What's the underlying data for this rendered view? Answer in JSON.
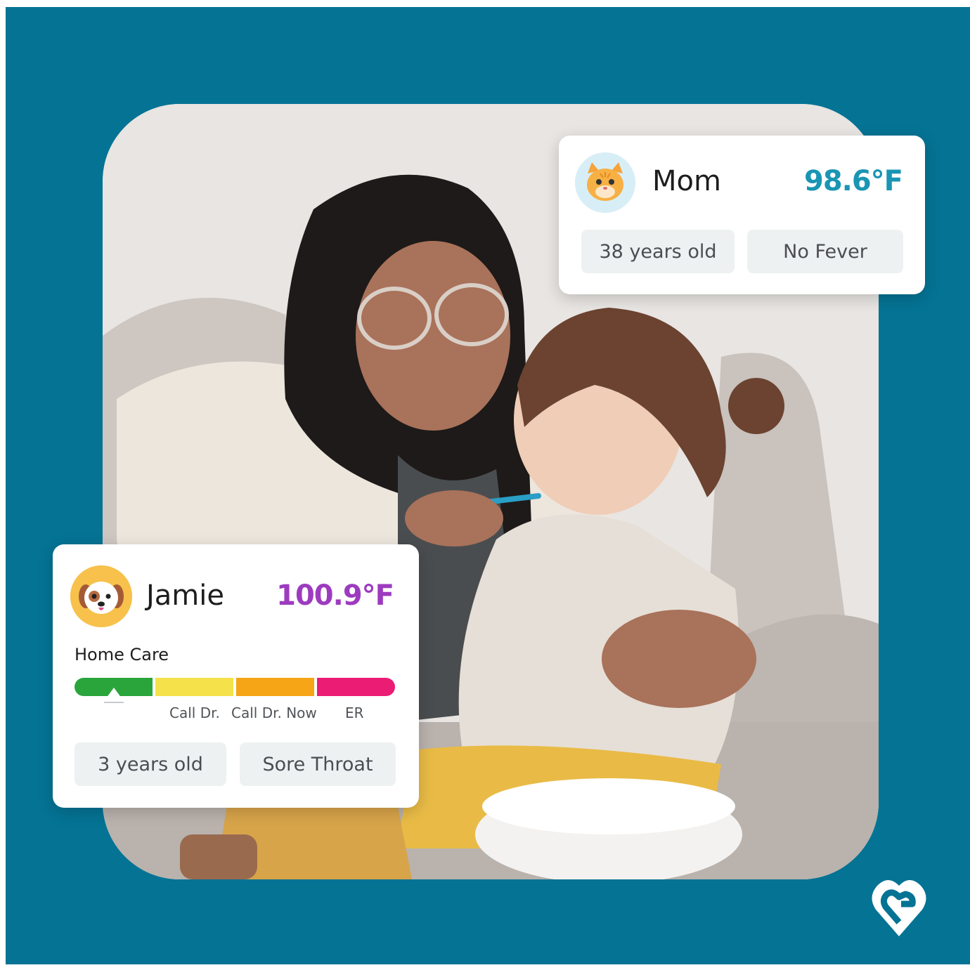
{
  "colors": {
    "frame": "#057394",
    "mom_temp": "#1a95b4",
    "jamie_temp": "#9d3bbf",
    "scale": [
      "#2aa53c",
      "#f5e14a",
      "#f5a515",
      "#ea1c74"
    ]
  },
  "mom_card": {
    "avatar_icon": "cat-icon",
    "name": "Mom",
    "temperature": "98.6°F",
    "age": "38 years old",
    "status": "No Fever"
  },
  "jamie_card": {
    "avatar_icon": "dog-icon",
    "name": "Jamie",
    "temperature": "100.9°F",
    "care_level": "Home Care",
    "scale_labels": [
      "Call Dr.",
      "Call Dr. Now",
      "ER"
    ],
    "age": "3 years old",
    "symptom": "Sore Throat"
  },
  "logo_icon": "heart-logo-icon"
}
